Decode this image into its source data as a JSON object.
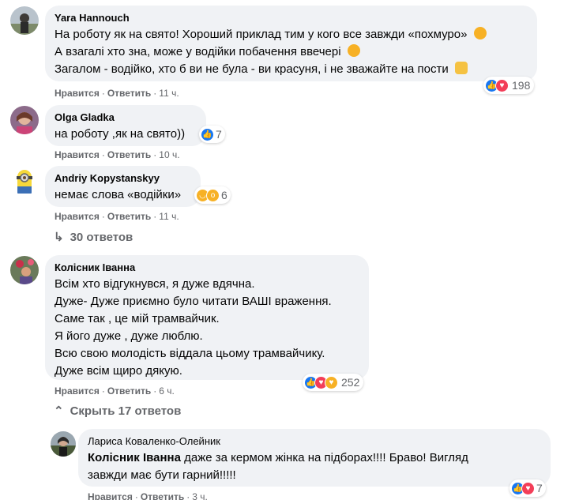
{
  "colors": {
    "bubble": "#f0f2f5",
    "like": "#1877f2",
    "love": "#f33e58",
    "haha": "#f7b125",
    "meta": "#65676b"
  },
  "comments": [
    {
      "author": "Yara Hannouch",
      "lines": [
        "На роботу як на свято! Хороший приклад тим у кого все завжди «похмуро»",
        "А взагалі хто зна, може у водійки побачення ввечері",
        "Загалом - водійко, хто б ви не була - ви красуня, і не зважайте на пости"
      ],
      "like_label": "Нравится",
      "reply_label": "Ответить",
      "time": "11 ч.",
      "reactions": [
        "like-icon",
        "love-icon"
      ],
      "reaction_count": "198"
    },
    {
      "author": "Olga Gladka",
      "lines": [
        "на роботу ,як на свято))"
      ],
      "like_label": "Нравится",
      "reply_label": "Ответить",
      "time": "10 ч.",
      "reactions": [
        "like-icon"
      ],
      "reaction_count": "7"
    },
    {
      "author": "Andriy Kopystanskyy",
      "lines": [
        "немає слова «водійки»"
      ],
      "like_label": "Нравится",
      "reply_label": "Ответить",
      "time": "11 ч.",
      "reactions": [
        "haha-icon",
        "wow-icon"
      ],
      "reaction_count": "6"
    },
    {
      "author": "Колісник Іванна",
      "lines": [
        "Всім хто відгукнувся, я дуже вдячна.",
        "Дуже- Дуже приємно було читати ВАШІ враження.",
        "Саме так , це мій трамвайчик.",
        "Я його дуже , дуже люблю.",
        "Всю свою молодість віддала цьому трамвайчику.",
        "Дуже всім щиро дякую."
      ],
      "like_label": "Нравится",
      "reply_label": "Ответить",
      "time": "6 ч.",
      "reactions": [
        "like-icon",
        "love-icon",
        "care-icon"
      ],
      "reaction_count": "252"
    }
  ],
  "replies_link_1": "30 ответов",
  "replies_link_2": "Скрыть 17 ответов",
  "reply": {
    "author": "Лариса Коваленко-Олейник",
    "mention": "Колісник Іванна",
    "line1": "даже за кермом жінка на підборах!!!! Браво! Вигляд",
    "line2": "завжди має бути гарний!!!!!",
    "like_label": "Нравится",
    "reply_label": "Ответить",
    "time": "3 ч.",
    "reactions": [
      "like-icon",
      "love-icon"
    ],
    "reaction_count": "7"
  }
}
